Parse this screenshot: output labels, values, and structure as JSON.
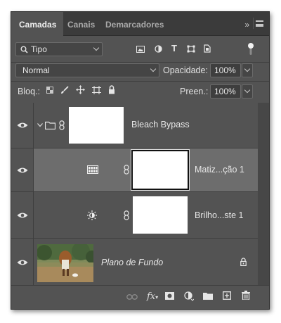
{
  "tabs": [
    {
      "label": "Camadas",
      "active": true
    },
    {
      "label": "Canais",
      "active": false
    },
    {
      "label": "Demarcadores",
      "active": false
    }
  ],
  "tab_overflow": "»",
  "filter": {
    "kind": "Tipo",
    "icons": [
      "image-filter-icon",
      "adjustment-filter-icon",
      "type-filter-icon",
      "shape-filter-icon",
      "smart-object-filter-icon",
      "filter-toggle-icon"
    ]
  },
  "blend": {
    "mode": "Normal",
    "opacity_label": "Opacidade:",
    "opacity": "100%"
  },
  "lock": {
    "label": "Bloq.:",
    "fill_label": "Preen.:",
    "fill": "100%"
  },
  "layers": [
    {
      "name": "Bleach Bypass",
      "type": "group",
      "selected": false
    },
    {
      "name": "Matiz...ção 1",
      "type": "adjustment-hue-saturation",
      "selected": true
    },
    {
      "name": "Brilho...ste 1",
      "type": "adjustment-brightness-contrast",
      "selected": false
    },
    {
      "name": "Plano de Fundo",
      "type": "background",
      "selected": false,
      "locked": true
    }
  ],
  "bottom_icons": [
    "link-layers-icon",
    "fx-icon",
    "add-mask-icon",
    "new-adjustment-icon",
    "new-group-icon",
    "new-layer-icon",
    "delete-layer-icon"
  ],
  "colors": {
    "panel": "#535353",
    "tabbar": "#3b3b3b",
    "selected_row": "#6d6d6d"
  }
}
